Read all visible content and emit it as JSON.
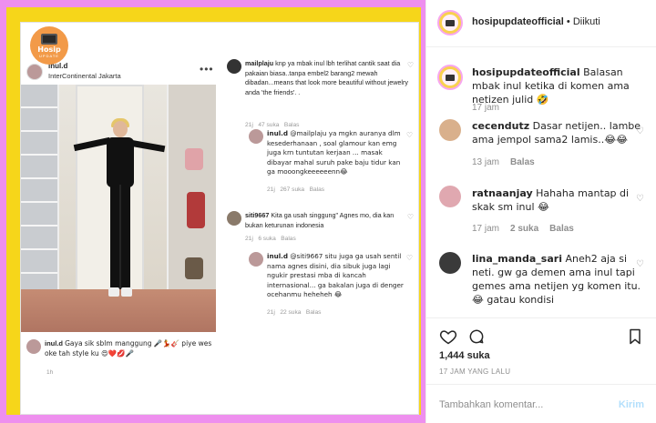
{
  "post": {
    "badge": {
      "title": "Hosip",
      "sub": "UPDATE"
    },
    "username": "inul.d",
    "location": "InterContinental Jakarta",
    "caption_user": "inul.d",
    "caption": "Gaya sik sblm manggung 🎤💃🎸 piye wes oke tah style ku 😍❤️💋🎤",
    "caption_time": "1h"
  },
  "reply_comments": [
    {
      "user": "mailplaju",
      "text": "knp ya mbak inul lbh terlihat cantik saat dia pakaian biasa..tanpa embel2 barang2 mewah dibadan...means that look more beautiful without jewelry anda 'the friends'. .",
      "time": "21j",
      "likes": "47 suka",
      "reply": "Balas"
    },
    {
      "user": "inul.d",
      "text": "@mailplaju ya mgkn auranya dlm kesederhanaan , soal glamour kan emg juga krn tuntutan kerjaan ... masak dibayar mahal suruh pake baju tidur kan ga mooongkeeeeeenn😂",
      "time": "21j",
      "likes": "267 suka",
      "reply": "Balas"
    },
    {
      "user": "siti9667",
      "text": "Kita ga usah singgung\" Agnes mo, dia kan bukan keturunan indonesia",
      "time": "21j",
      "likes": "6 suka",
      "reply": "Balas"
    },
    {
      "user": "inul.d",
      "text": "@siti9667 situ juga ga usah sentil nama agnes disini, dia sibuk juga lagi ngukir prestasi mba di kancah internasional... ga bakalan juga di denger ocehanmu heheheh 😂",
      "time": "21j",
      "likes": "22 suka",
      "reply": "Balas"
    }
  ],
  "sidebar": {
    "username": "hosipupdateofficial",
    "follow_status": "• Diikuti",
    "comments": [
      {
        "user": "hosipupdateofficial",
        "text": "Balasan mbak inul ketika di komen ama netizen julid 🤣",
        "time": "17 jam"
      },
      {
        "user": "cecendutz",
        "text": "Dasar netijen.. lambe ama jempol sama2 lamis..😂😂",
        "time": "13 jam",
        "reply": "Balas"
      },
      {
        "user": "ratnaanjay",
        "text": "Hahaha mantap di skak sm inul 😂",
        "time": "17 jam",
        "likes": "2 suka",
        "reply": "Balas"
      },
      {
        "user": "lina_manda_sari",
        "text": "Aneh2 aja si neti. gw ga demen ama inul tapi gemes ama netijen yg komen itu. 😂 gatau kondisi",
        "time": "",
        "reply": ""
      }
    ],
    "likes": "1,444 suka",
    "date": "17 JAM YANG LALU",
    "comment_placeholder": "Tambahkan komentar...",
    "send_label": "Kirim"
  }
}
